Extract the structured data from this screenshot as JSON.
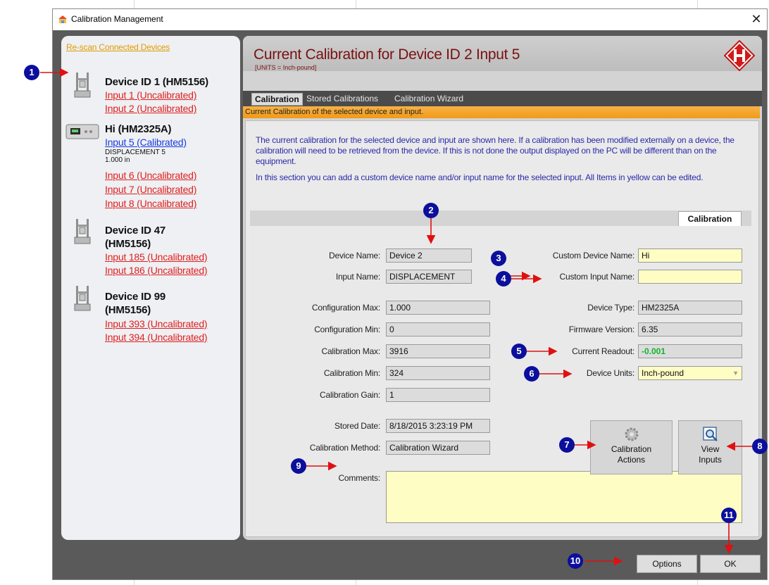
{
  "window": {
    "title": "Calibration Management",
    "close_glyph": "✕",
    "app_icon": "calibration-app-icon"
  },
  "left_panel": {
    "rescan_label": "Re-scan Connected Devices",
    "devices": [
      {
        "name": "Device ID 1 (HM5156)",
        "icon": "load-frame-icon",
        "inputs": [
          {
            "label": "Input 1 (Uncalibrated)",
            "status": "uncalibrated"
          },
          {
            "label": "Input 2 (Uncalibrated)",
            "status": "uncalibrated"
          }
        ]
      },
      {
        "name": "Hi (HM2325A)",
        "icon": "data-logger-icon",
        "inputs": [
          {
            "label": "Input 5 (Calibrated)",
            "status": "calibrated",
            "subtitle": "DISPLACEMENT 5",
            "reading": "1.000 in"
          },
          {
            "label": "Input 6 (Uncalibrated)",
            "status": "uncalibrated"
          },
          {
            "label": "Input 7 (Uncalibrated)",
            "status": "uncalibrated"
          },
          {
            "label": "Input 8 (Uncalibrated)",
            "status": "uncalibrated"
          }
        ]
      },
      {
        "name_line1": "Device ID 47",
        "name_line2": "(HM5156)",
        "icon": "load-frame-icon",
        "inputs": [
          {
            "label": "Input 185 (Uncalibrated)",
            "status": "uncalibrated"
          },
          {
            "label": "Input 186 (Uncalibrated)",
            "status": "uncalibrated"
          }
        ]
      },
      {
        "name_line1": "Device ID 99",
        "name_line2": "(HM5156)",
        "icon": "load-frame-icon",
        "inputs": [
          {
            "label": "Input 393 (Uncalibrated)",
            "status": "uncalibrated"
          },
          {
            "label": "Input 394 (Uncalibrated)",
            "status": "uncalibrated"
          }
        ]
      }
    ]
  },
  "header": {
    "title": "Current Calibration for Device ID 2 Input 5",
    "units": "[UNITS = Inch-pound]",
    "logo": "h-logo-icon"
  },
  "tabs": [
    "Calibration",
    "Stored Calibrations",
    "Calibration Wizard"
  ],
  "info_bar": "Current Calibration of the selected device and  input.",
  "description": {
    "p1": "The current calibration for the selected device and input are shown here.  If a calibration has been modified externally on a device, the calibration will need to be retrieved from the device.  If this is not done the output displayed on the PC will be different than on the equipment.",
    "p2": "In this section you can add a custom device name and/or input name for the selected input.  All Items in yellow can be edited."
  },
  "inner_tab": "Calibration",
  "fields": {
    "device_name": {
      "label": "Device Name:",
      "value": "Device 2"
    },
    "input_name": {
      "label": "Input Name:",
      "value": "DISPLACEMENT"
    },
    "custom_device_name": {
      "label": "Custom Device Name:",
      "value": "Hi"
    },
    "custom_input_name": {
      "label": "Custom Input Name:",
      "value": ""
    },
    "configuration_max": {
      "label": "Configuration Max:",
      "value": "1.000"
    },
    "configuration_min": {
      "label": "Configuration Min:",
      "value": "0"
    },
    "calibration_max": {
      "label": "Calibration Max:",
      "value": "3916"
    },
    "calibration_min": {
      "label": "Calibration Min:",
      "value": "324"
    },
    "calibration_gain": {
      "label": "Calibration Gain:",
      "value": "1"
    },
    "device_type": {
      "label": "Device Type:",
      "value": "HM2325A"
    },
    "firmware_version": {
      "label": "Firmware Version:",
      "value": "6.35"
    },
    "current_readout": {
      "label": "Current Readout:",
      "value": "-0.001"
    },
    "device_units": {
      "label": "Device Units:",
      "value": "Inch-pound"
    },
    "stored_date": {
      "label": "Stored Date:",
      "value": "8/18/2015 3:23:19 PM"
    },
    "calibration_method": {
      "label": "Calibration Method:",
      "value": "Calibration Wizard"
    },
    "comments": {
      "label": "Comments:",
      "value": ""
    }
  },
  "actions": {
    "calibration_actions_line1": "Calibration",
    "calibration_actions_line2": "Actions",
    "calibration_actions_icon": "gear-icon",
    "view_inputs_line1": "View",
    "view_inputs_line2": "Inputs",
    "view_inputs_icon": "magnifier-icon"
  },
  "footer": {
    "options_label": "Options",
    "ok_label": "OK"
  },
  "callouts": [
    "1",
    "2",
    "3",
    "4",
    "5",
    "6",
    "7",
    "8",
    "9",
    "10",
    "11"
  ],
  "colors": {
    "callout": "#0b0f9c",
    "arrow": "#e01010",
    "uncalibrated_link": "#e02020",
    "calibrated_link": "#1a3ce0",
    "editable_field": "#fdfdc4",
    "info_bar": "#f19a17",
    "title": "#7a1010"
  }
}
